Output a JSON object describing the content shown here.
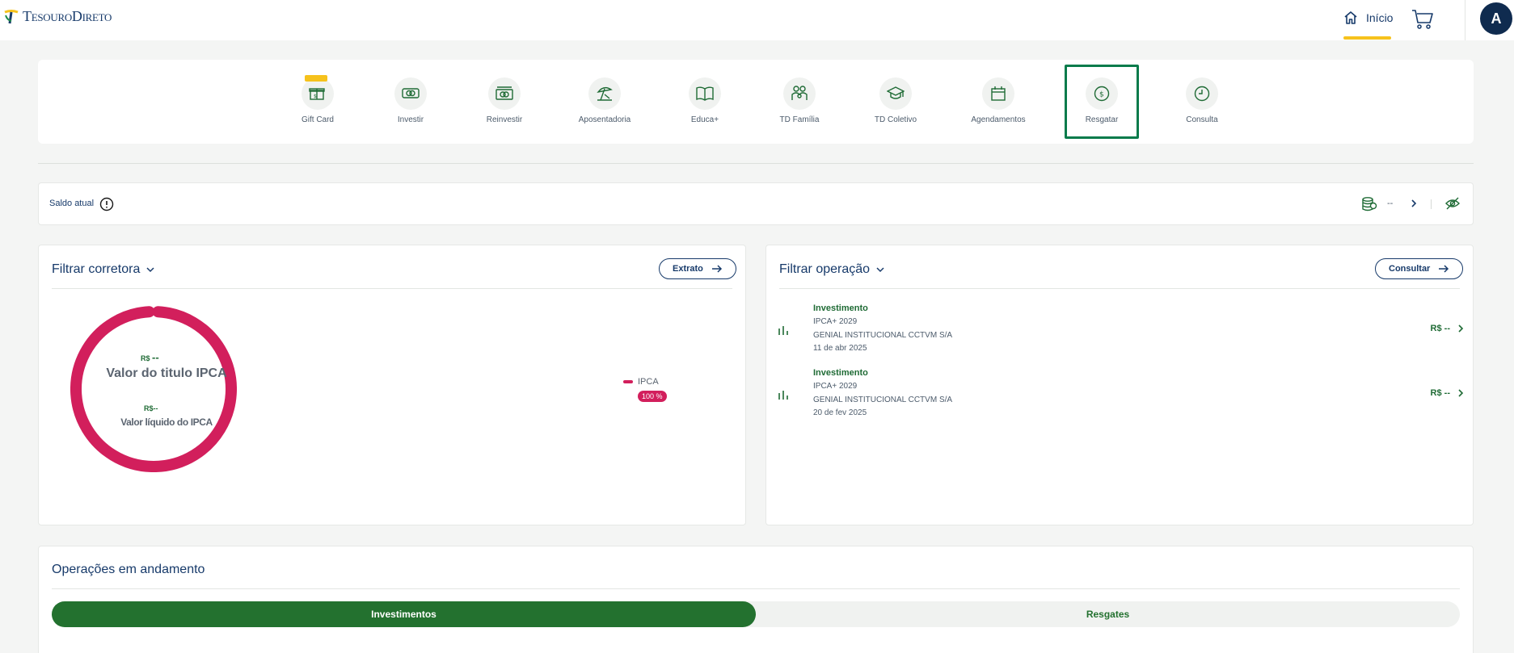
{
  "header": {
    "logo_text": "TesouroDireto",
    "home_label": "Início",
    "avatar_initial": "A",
    "accent_color": "#f6c21c"
  },
  "actions": [
    {
      "label": "Gift Card",
      "icon": "gift-icon",
      "badge": "new"
    },
    {
      "label": "Investir",
      "icon": "money-icon"
    },
    {
      "label": "Reinvestir",
      "icon": "money-stack-icon"
    },
    {
      "label": "Aposentadoria",
      "icon": "beach-umbrella-icon"
    },
    {
      "label": "Educa+",
      "icon": "book-icon"
    },
    {
      "label": "TD Família",
      "icon": "family-icon"
    },
    {
      "label": "TD Coletivo",
      "icon": "graduation-cap-icon"
    },
    {
      "label": "Agendamentos",
      "icon": "calendar-icon"
    },
    {
      "label": "Resgatar",
      "icon": "dollar-circle-icon",
      "selected": true
    },
    {
      "label": "Consulta",
      "icon": "clock-icon"
    }
  ],
  "balance": {
    "label": "Saldo atual",
    "value": "--"
  },
  "broker_card": {
    "title": "Filtrar corretora",
    "button_label": "Extrato",
    "donut_currency_1": "R$",
    "donut_value_1": "--",
    "donut_title": "Valor do titulo IPCA",
    "donut_currency_2": "R$",
    "donut_value_2": "--",
    "donut_subtitle": "Valor líquido do IPCA",
    "legend_label": "IPCA",
    "legend_percent": "100 %",
    "color": "#d21f5c"
  },
  "operations_card": {
    "title": "Filtrar operação",
    "button_label": "Consultar",
    "items": [
      {
        "type": "Investimento",
        "title": "IPCA+ 2029",
        "broker": "GENIAL INSTITUCIONAL CCTVM S/A",
        "date": "11 de abr 2025",
        "amount": "R$ --"
      },
      {
        "type": "Investimento",
        "title": "IPCA+ 2029",
        "broker": "GENIAL INSTITUCIONAL CCTVM S/A",
        "date": "20 de fev 2025",
        "amount": "R$ --"
      }
    ]
  },
  "ongoing": {
    "title": "Operações em andamento",
    "tabs": [
      {
        "label": "Investimentos",
        "active": true
      },
      {
        "label": "Resgates",
        "active": false
      }
    ]
  }
}
